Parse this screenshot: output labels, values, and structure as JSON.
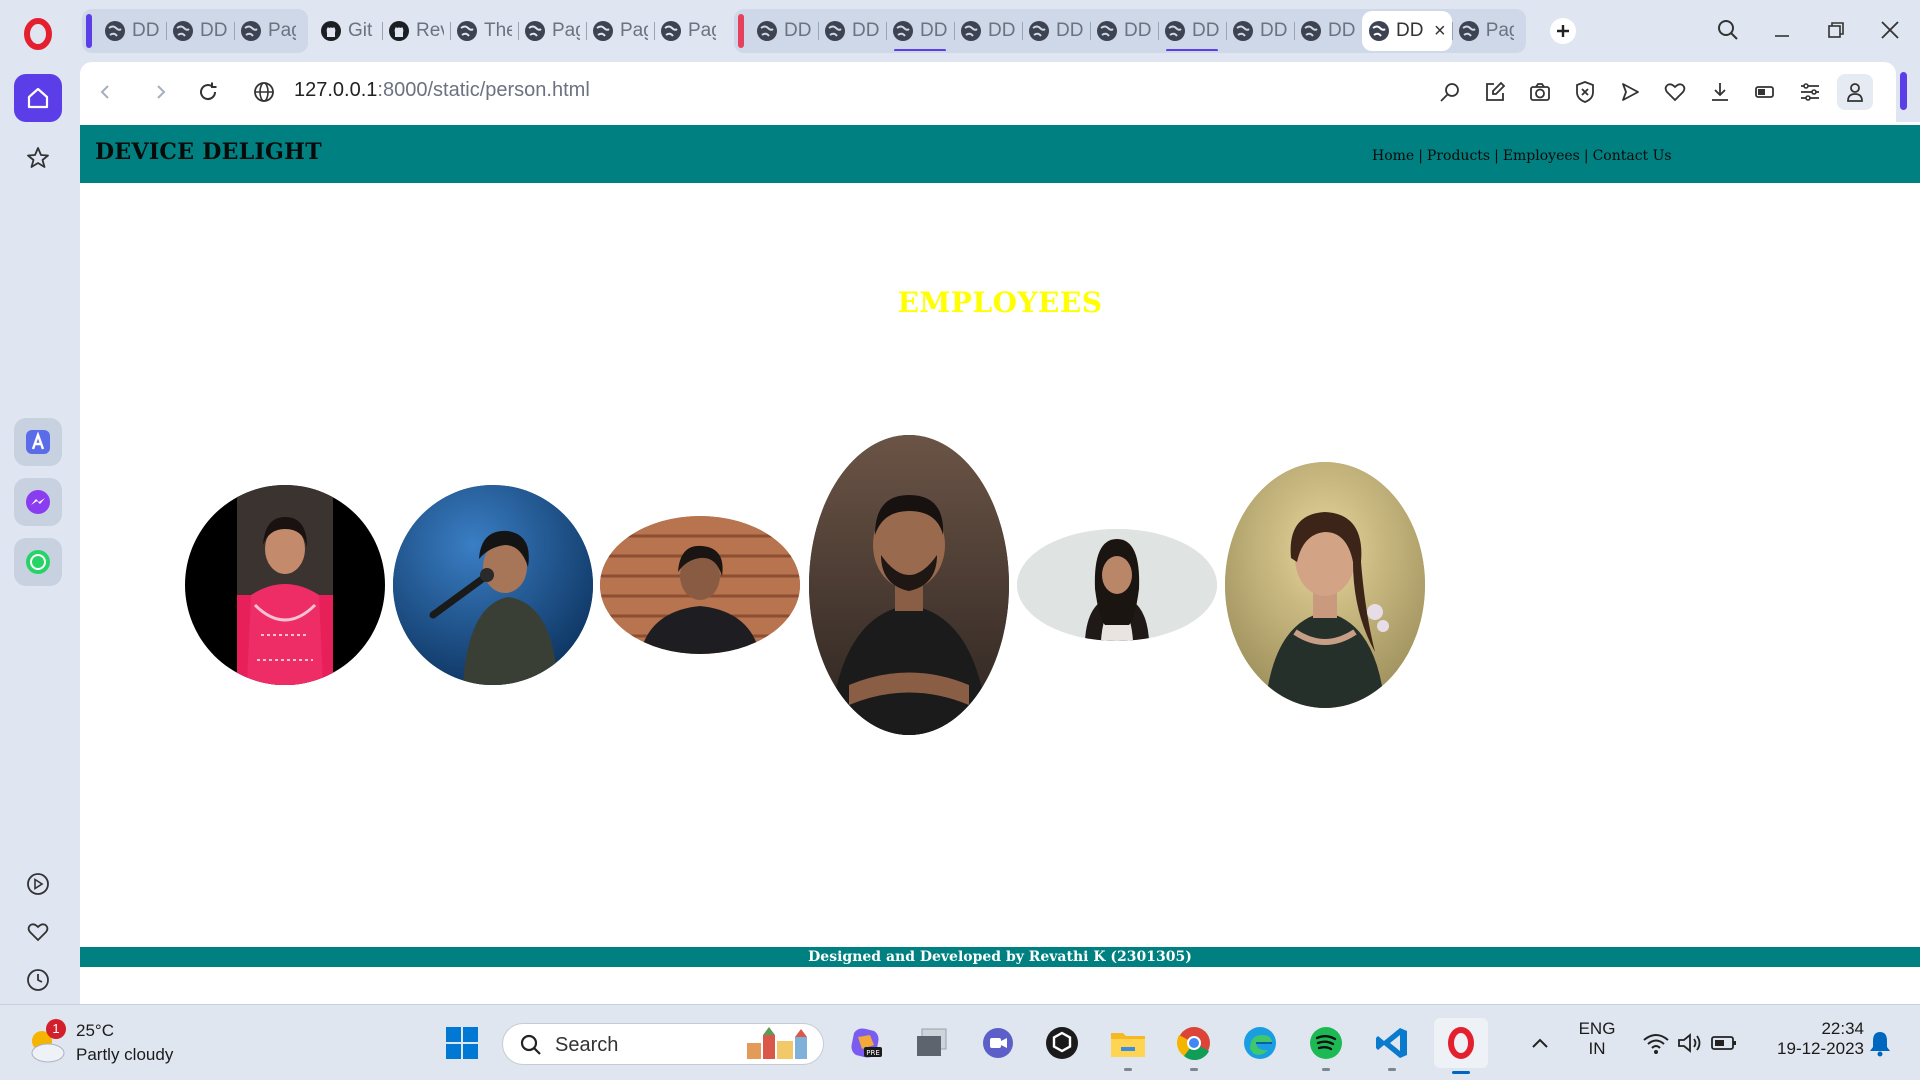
{
  "browser": {
    "tabs": [
      {
        "label": "DD",
        "group": 1
      },
      {
        "label": "DD",
        "group": 1
      },
      {
        "label": "Pag",
        "group": 1
      },
      {
        "label": "Git",
        "group": 2
      },
      {
        "label": "Rev",
        "group": 2
      },
      {
        "label": "The",
        "group": 2
      },
      {
        "label": "Pag",
        "group": 2
      },
      {
        "label": "Pag",
        "group": 2
      },
      {
        "label": "Pag",
        "group": 2
      },
      {
        "label": "DD",
        "group": 3
      },
      {
        "label": "DD",
        "group": 3
      },
      {
        "label": "DD",
        "group": 3
      },
      {
        "label": "DD",
        "group": 3
      },
      {
        "label": "DD",
        "group": 3
      },
      {
        "label": "DD",
        "group": 3
      },
      {
        "label": "DD",
        "group": 3
      },
      {
        "label": "DD",
        "group": 3
      },
      {
        "label": "DD",
        "group": 3
      },
      {
        "label": "DD",
        "group": 3
      },
      {
        "label": "DD",
        "group": 3
      },
      {
        "label": "Pag",
        "group": 3
      }
    ],
    "active_tab_close": "×",
    "url": {
      "host": "127.0.0.1",
      "rest": ":8000/static/person.html"
    },
    "accent_color": "#5b3ee8"
  },
  "site": {
    "brand": "DEVICE DELIGHT",
    "nav": [
      "Home",
      "Products",
      "Employees",
      "Contact Us"
    ],
    "nav_separator": "|",
    "heading": "EMPLOYEES",
    "footer": "Designed and Developed by Revathi K (2301305)",
    "header_color": "#008080",
    "heading_color": "#ffff00"
  },
  "employees": [
    {
      "name": "employee-photo-1",
      "bg": "#000000",
      "figure": "#e8205a"
    },
    {
      "name": "employee-photo-2",
      "bg": "#0e4a86",
      "figure": "#2a2e2c"
    },
    {
      "name": "employee-photo-3",
      "bg": "#b8734f",
      "figure": "#1e1e22"
    },
    {
      "name": "employee-photo-4",
      "bg": "#4a3c34",
      "figure": "#1b1b1b"
    },
    {
      "name": "employee-photo-5",
      "bg": "#dfe3e2",
      "figure": "#1f1a18"
    },
    {
      "name": "employee-photo-6",
      "bg": "#c9b77a",
      "figure": "#26302a"
    }
  ],
  "taskbar": {
    "weather": {
      "temp": "25°C",
      "condition": "Partly cloudy",
      "badge": "1"
    },
    "search_placeholder": "Search",
    "language": {
      "line1": "ENG",
      "line2": "IN"
    },
    "clock": {
      "time": "22:34",
      "date": "19-12-2023"
    }
  }
}
